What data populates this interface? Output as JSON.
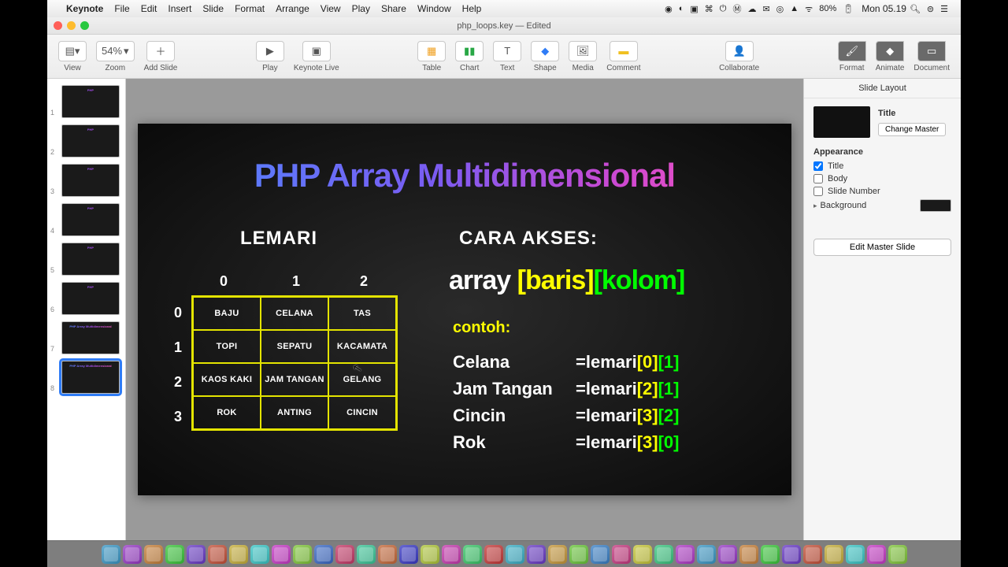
{
  "menubar": {
    "app": "Keynote",
    "items": [
      "File",
      "Edit",
      "Insert",
      "Slide",
      "Format",
      "Arrange",
      "View",
      "Play",
      "Share",
      "Window",
      "Help"
    ],
    "battery": "80%",
    "clock": "Mon 05.19"
  },
  "window": {
    "title": "php_loops.key — Edited"
  },
  "toolbar": {
    "view": "View",
    "zoom": "Zoom",
    "zoom_value": "54%",
    "add_slide": "Add Slide",
    "play": "Play",
    "keynote_live": "Keynote Live",
    "table": "Table",
    "chart": "Chart",
    "text": "Text",
    "shape": "Shape",
    "media": "Media",
    "comment": "Comment",
    "collaborate": "Collaborate",
    "format": "Format",
    "animate": "Animate",
    "document": "Document"
  },
  "thumbs": {
    "count": 8,
    "active": 8
  },
  "slide": {
    "title": "PHP Array Multidimensional",
    "lemari": "LEMARI",
    "cara_akses": "CARA AKSES:",
    "col_headers": [
      "0",
      "1",
      "2"
    ],
    "row_headers": [
      "0",
      "1",
      "2",
      "3"
    ],
    "grid": [
      [
        "BAJU",
        "CELANA",
        "TAS"
      ],
      [
        "TOPI",
        "SEPATU",
        "KACAMATA"
      ],
      [
        "KAOS KAKI",
        "JAM TANGAN",
        "GELANG"
      ],
      [
        "ROK",
        "ANTING",
        "CINCIN"
      ]
    ],
    "syntax_array": "array",
    "syntax_baris": "[baris]",
    "syntax_kolom": "[kolom]",
    "contoh": "contoh:",
    "examples": [
      {
        "name": "Celana",
        "arr": "lemari",
        "i": "[0]",
        "j": "[1]"
      },
      {
        "name": "Jam Tangan",
        "arr": "lemari",
        "i": "[2]",
        "j": "[1]"
      },
      {
        "name": "Cincin",
        "arr": "lemari",
        "i": "[3]",
        "j": "[2]"
      },
      {
        "name": "Rok",
        "arr": "lemari",
        "i": "[3]",
        "j": "[0]"
      }
    ]
  },
  "inspector": {
    "tabs": {
      "format": "Format",
      "animate": "Animate",
      "document": "Document"
    },
    "heading": "Slide Layout",
    "master_title": "Title",
    "change_master": "Change Master",
    "appearance": "Appearance",
    "chk_title": "Title",
    "chk_body": "Body",
    "chk_slidenum": "Slide Number",
    "background": "Background",
    "edit_master": "Edit Master Slide"
  }
}
